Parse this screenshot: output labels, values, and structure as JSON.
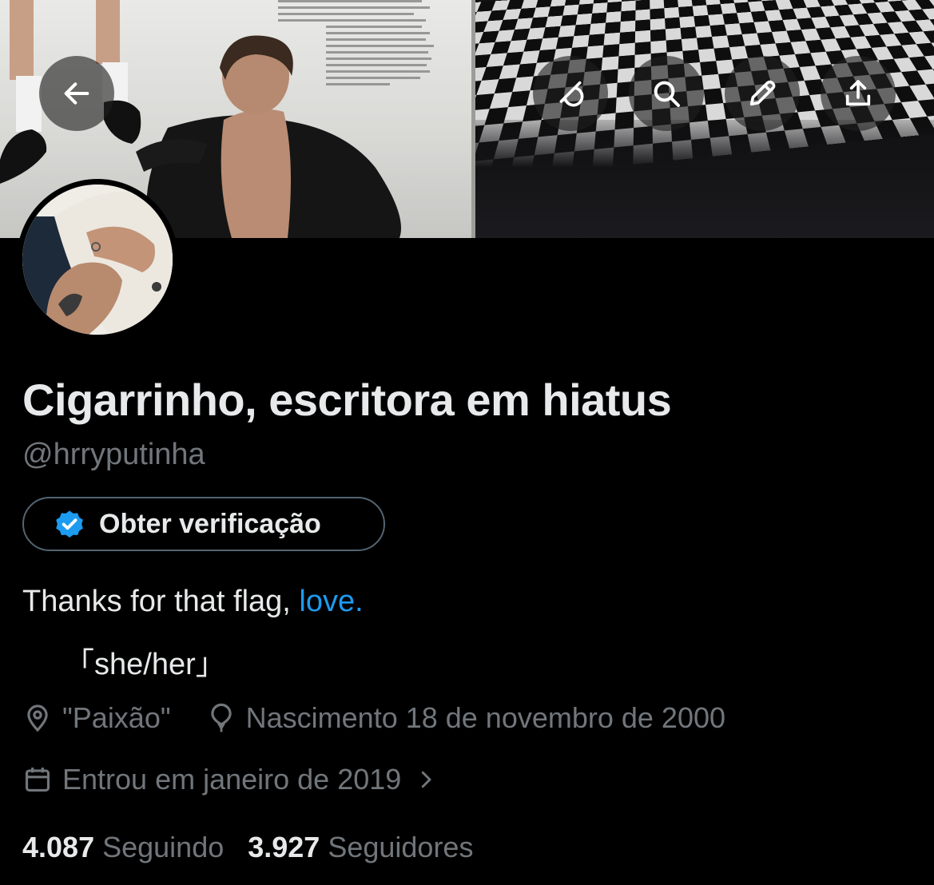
{
  "profile": {
    "display_name": "Cigarrinho, escritora em hiatus",
    "handle": "@hrryputinha",
    "verify_label": "Obter verificação",
    "bio_text": "Thanks for that flag, ",
    "bio_link": "love.",
    "bio_line2": "「she/her」",
    "location": "\"Paixão\"",
    "birthday": "Nascimento 18 de novembro de 2000",
    "joined": "Entrou em janeiro de 2019",
    "following_count": "4.087",
    "following_label": "Seguindo",
    "followers_count": "3.927",
    "followers_label": "Seguidores"
  },
  "icons": {
    "back": "arrow-left-icon",
    "grok": "grok-icon",
    "search": "search-icon",
    "edit": "pencil-icon",
    "share": "share-icon",
    "verified": "verified-badge-icon",
    "location": "location-pin-icon",
    "birthday": "balloon-icon",
    "calendar": "calendar-icon",
    "chevron": "chevron-right-icon"
  },
  "colors": {
    "background": "#000000",
    "text_primary": "#e7e9ea",
    "text_secondary": "#71767b",
    "link": "#1d9bf0",
    "border": "#536471"
  }
}
